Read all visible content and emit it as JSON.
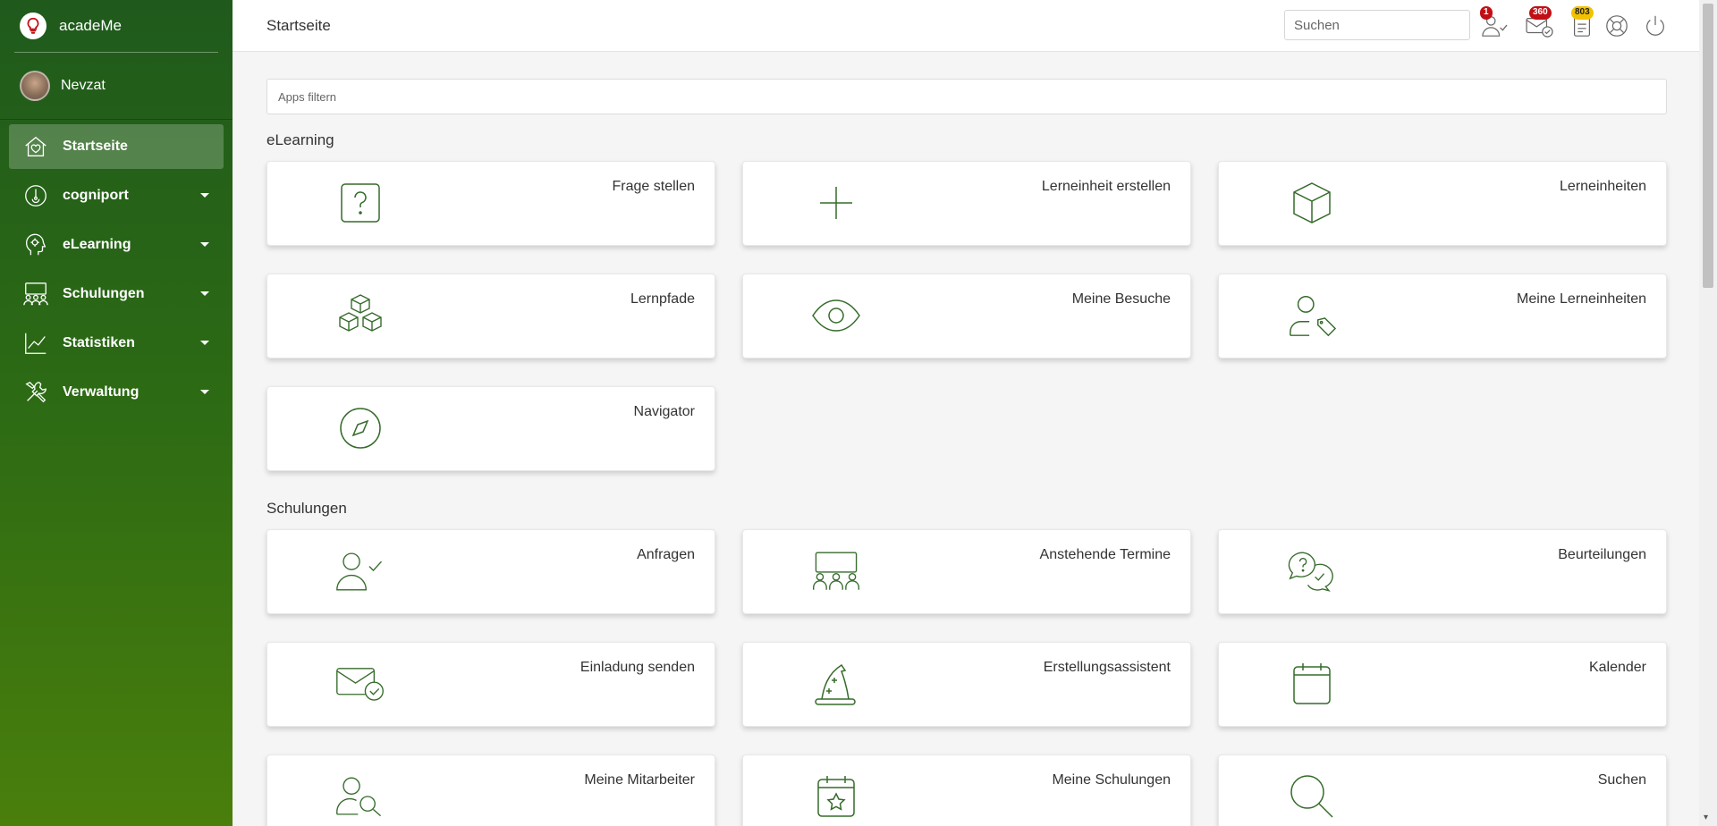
{
  "app": {
    "name": "acadeMe"
  },
  "user": {
    "name": "Nevzat"
  },
  "sidebar": {
    "items": [
      {
        "label": "Startseite",
        "icon": "home-heart-icon",
        "active": true
      },
      {
        "label": "cogniport",
        "icon": "dashboard-gauge-icon"
      },
      {
        "label": "eLearning",
        "icon": "head-gear-icon"
      },
      {
        "label": "Schulungen",
        "icon": "group-presentation-icon"
      },
      {
        "label": "Statistiken",
        "icon": "line-chart-icon"
      },
      {
        "label": "Verwaltung",
        "icon": "tools-icon"
      }
    ]
  },
  "header": {
    "title": "Startseite",
    "search_placeholder": "Suchen",
    "badges": {
      "requests": "1",
      "messages": "360",
      "tasks": "803"
    }
  },
  "main": {
    "filter_placeholder": "Apps filtern",
    "sections": [
      {
        "title": "eLearning",
        "cards": [
          {
            "label": "Frage stellen",
            "icon": "question-icon"
          },
          {
            "label": "Lerneinheit erstellen",
            "icon": "plus-icon"
          },
          {
            "label": "Lerneinheiten",
            "icon": "cube-icon"
          },
          {
            "label": "Lernpfade",
            "icon": "cubes-icon"
          },
          {
            "label": "Meine Besuche",
            "icon": "eye-icon"
          },
          {
            "label": "Meine Lerneinheiten",
            "icon": "user-tag-icon"
          },
          {
            "label": "Navigator",
            "icon": "compass-icon"
          }
        ]
      },
      {
        "title": "Schulungen",
        "cards": [
          {
            "label": "Anfragen",
            "icon": "user-check-icon"
          },
          {
            "label": "Anstehende Termine",
            "icon": "presentation-group-icon"
          },
          {
            "label": "Beurteilungen",
            "icon": "chat-bubbles-icon"
          },
          {
            "label": "Einladung senden",
            "icon": "mail-check-icon"
          },
          {
            "label": "Erstellungsassistent",
            "icon": "wizard-hat-icon"
          },
          {
            "label": "Kalender",
            "icon": "calendar-icon"
          },
          {
            "label": "Meine Mitarbeiter",
            "icon": "user-search-icon"
          },
          {
            "label": "Meine Schulungen",
            "icon": "calendar-star-icon"
          },
          {
            "label": "Suchen",
            "icon": "search-icon"
          }
        ]
      }
    ]
  },
  "colors": {
    "accent": "#2e6b16",
    "icon": "#356b2a",
    "badge_red": "#c10f15",
    "badge_yellow": "#f2c200"
  }
}
